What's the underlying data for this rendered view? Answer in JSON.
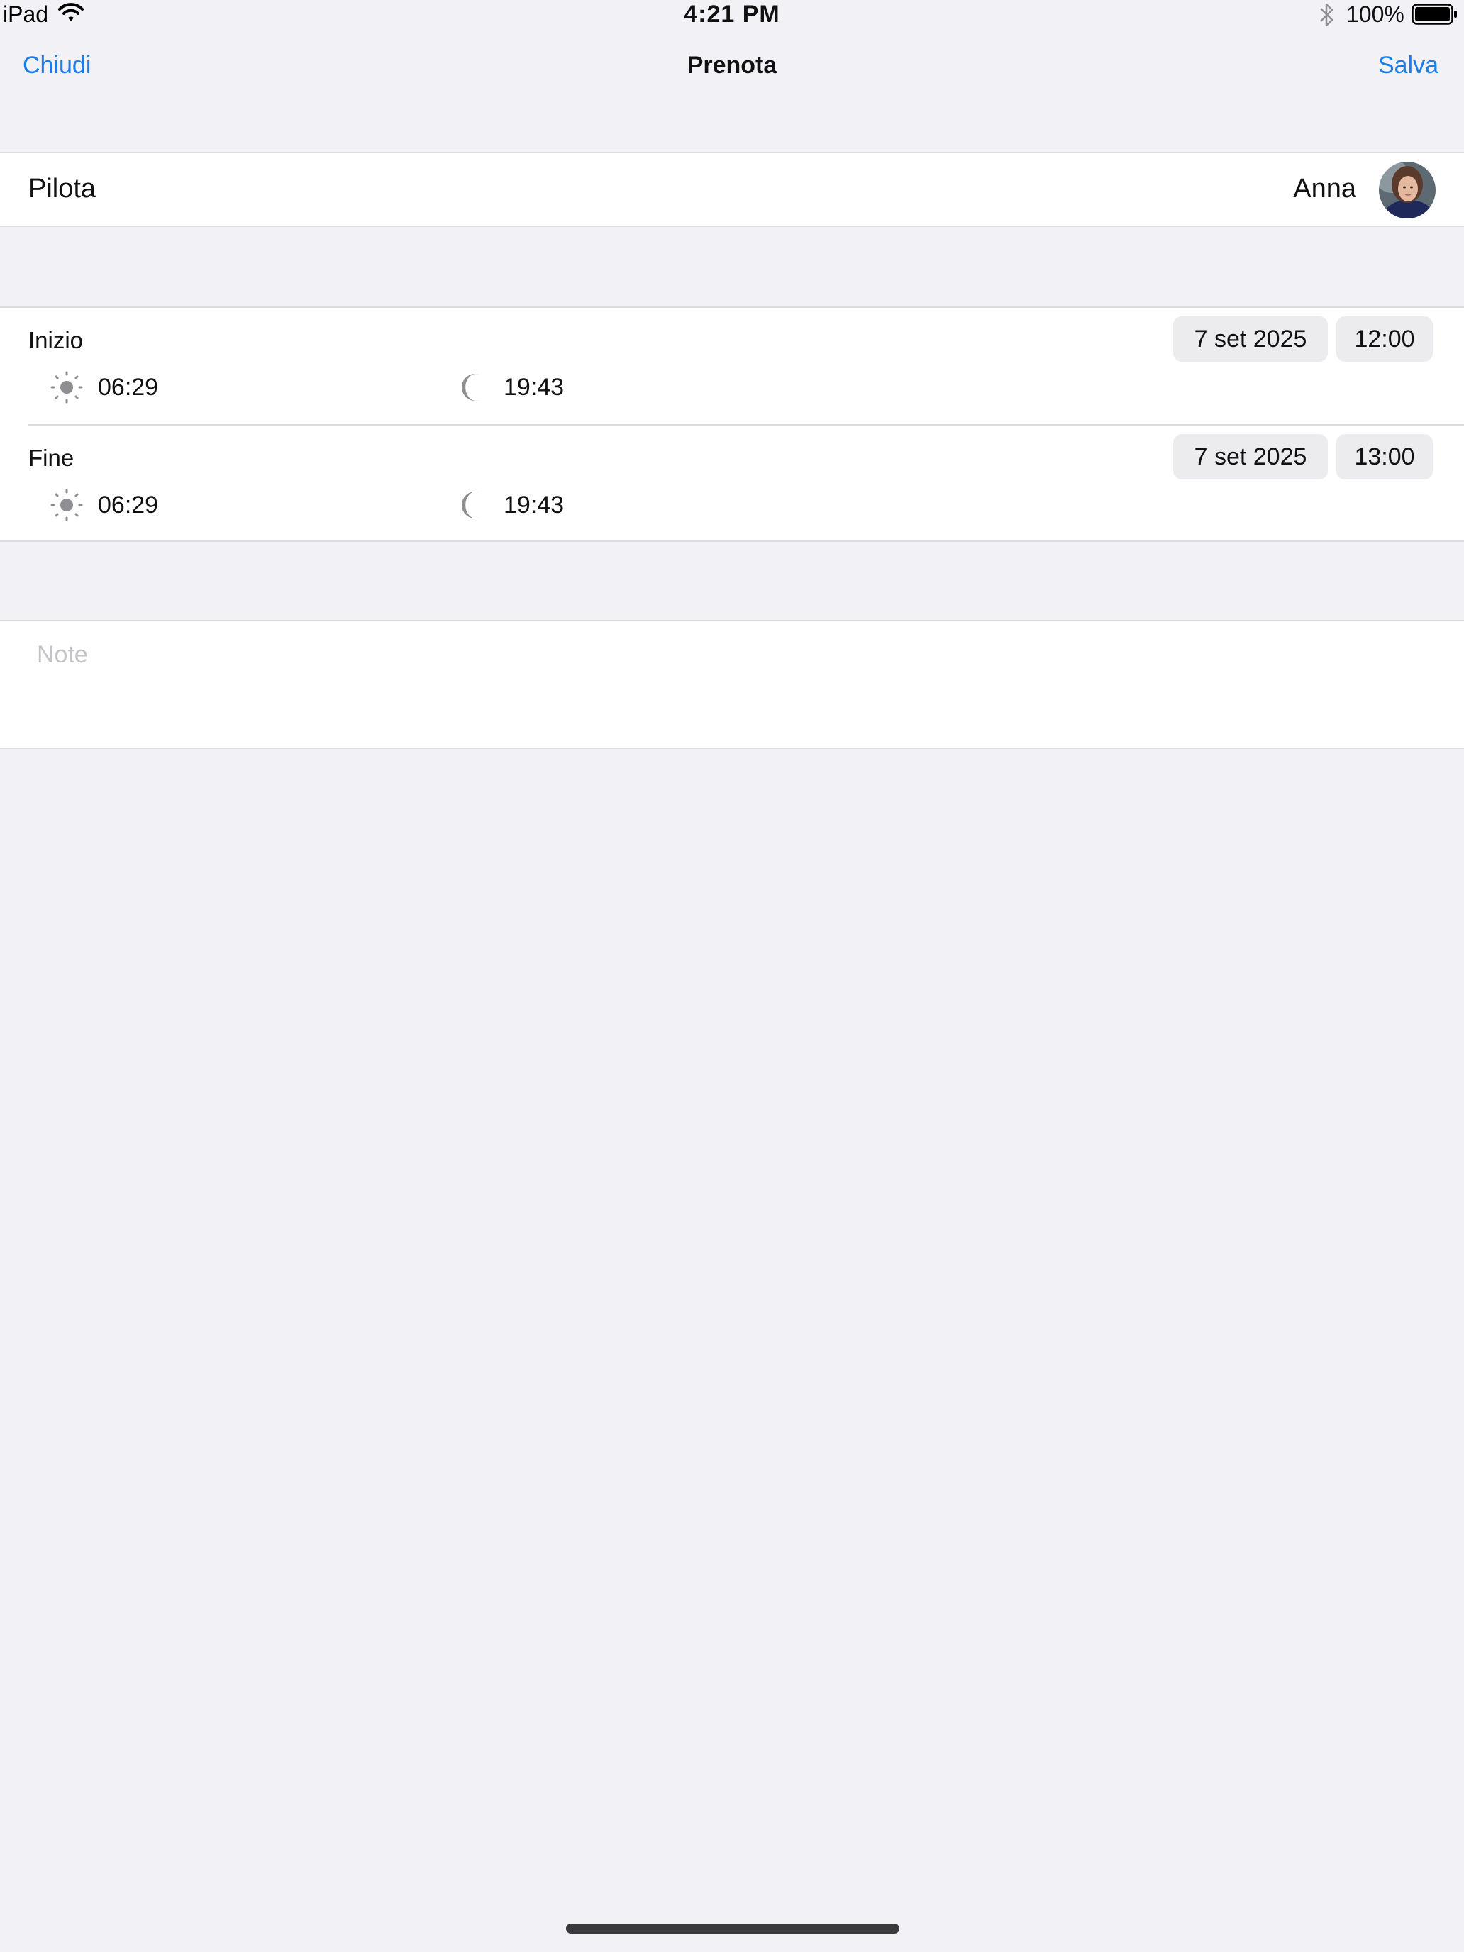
{
  "status_bar": {
    "device": "iPad",
    "time": "4:21 PM",
    "battery": "100%"
  },
  "nav": {
    "close_label": "Chiudi",
    "title": "Prenota",
    "save_label": "Salva"
  },
  "pilot": {
    "label": "Pilota",
    "name": "Anna"
  },
  "start": {
    "label": "Inizio",
    "date": "7 set 2025",
    "time": "12:00",
    "sunrise": "06:29",
    "sunset": "19:43"
  },
  "end": {
    "label": "Fine",
    "date": "7 set 2025",
    "time": "13:00",
    "sunrise": "06:29",
    "sunset": "19:43"
  },
  "notes": {
    "placeholder": "Note",
    "value": ""
  },
  "colors": {
    "accent": "#1b7ee8",
    "background": "#f1f1f6",
    "pill": "#ececee",
    "icon": "#8e8e93"
  },
  "icons": {
    "wifi": "wifi-icon",
    "bluetooth": "bluetooth-icon",
    "battery": "battery-icon",
    "sunrise": "sun-icon",
    "sunset": "moon-icon"
  }
}
